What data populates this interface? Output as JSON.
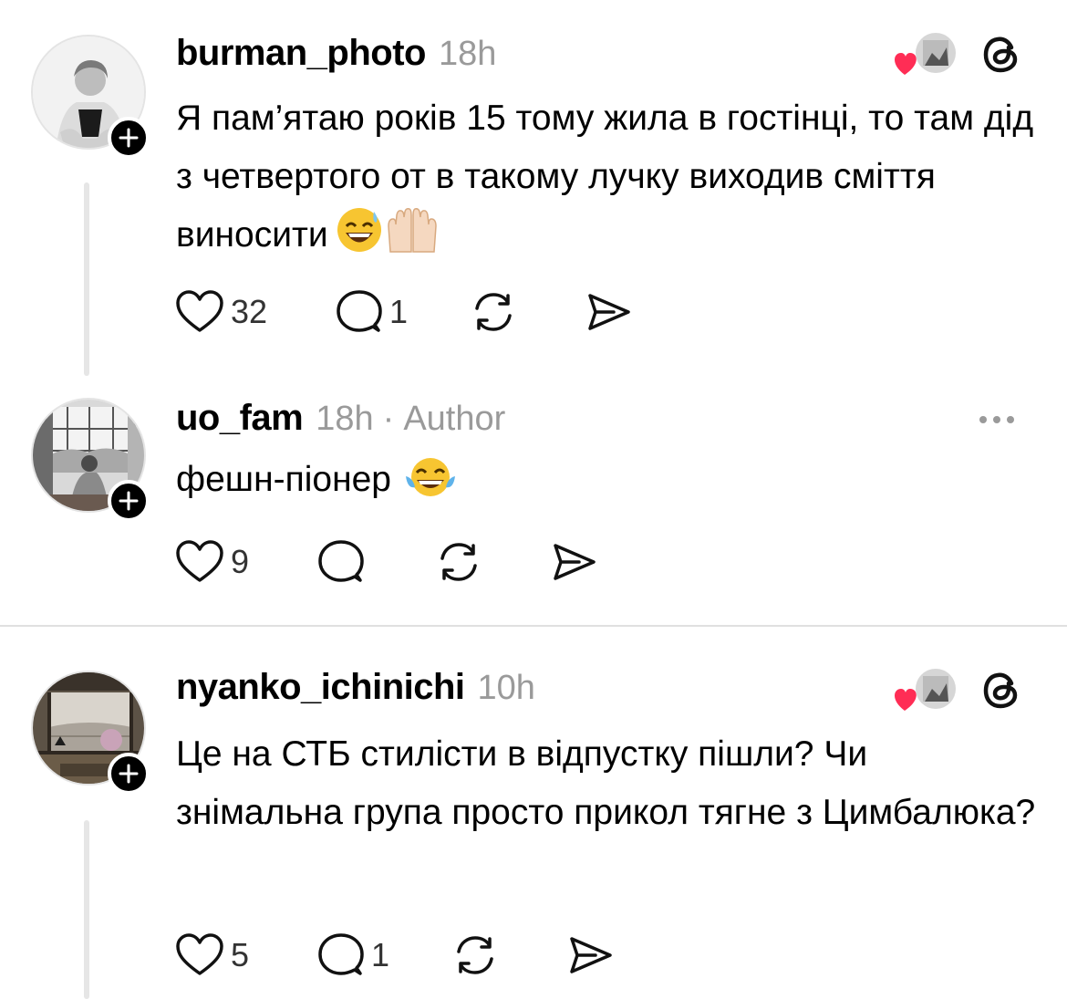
{
  "comments": [
    {
      "username": "burman_photo",
      "time": "18h",
      "text": "Я пам’ятаю років 15 тому жила в гостінці, то там дід з четвертого от в такому лучку виходив сміття виносити",
      "emojis": [
        "grinning-sweat-emoji",
        "palms-up-emoji"
      ],
      "likes": "32",
      "replies": "1"
    },
    {
      "username": "uo_fam",
      "time": "18h",
      "separator": "·",
      "badge": "Author",
      "text": "фешн-піонер",
      "emojis": [
        "tears-of-joy-emoji"
      ],
      "likes": "9",
      "replies": ""
    },
    {
      "username": "nyanko_ichinichi",
      "time": "10h",
      "text": "Це на СТБ стилісти в відпустку пішли? Чи знімальна група просто прикол тягне з Цимбалюка?",
      "likes": "5",
      "replies": "1"
    }
  ],
  "colors": {
    "heart": "#ff2d55",
    "muted": "#9a9a9a",
    "thread_line": "#e6e6e6"
  }
}
